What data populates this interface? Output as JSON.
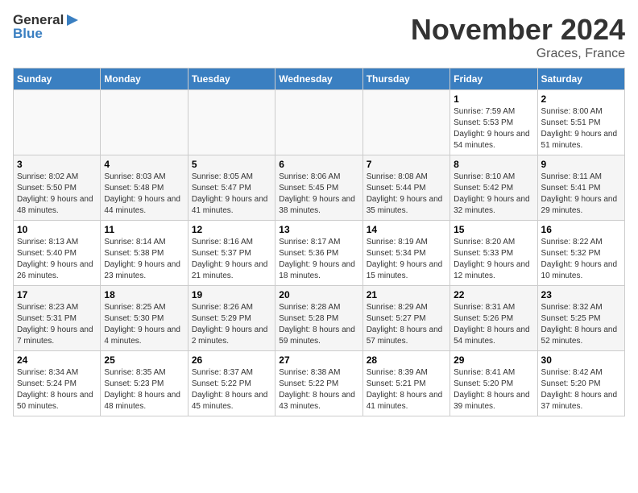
{
  "header": {
    "logo_general": "General",
    "logo_blue": "Blue",
    "month_title": "November 2024",
    "location": "Graces, France"
  },
  "days_of_week": [
    "Sunday",
    "Monday",
    "Tuesday",
    "Wednesday",
    "Thursday",
    "Friday",
    "Saturday"
  ],
  "weeks": [
    [
      {
        "day": "",
        "detail": ""
      },
      {
        "day": "",
        "detail": ""
      },
      {
        "day": "",
        "detail": ""
      },
      {
        "day": "",
        "detail": ""
      },
      {
        "day": "",
        "detail": ""
      },
      {
        "day": "1",
        "detail": "Sunrise: 7:59 AM\nSunset: 5:53 PM\nDaylight: 9 hours\nand 54 minutes."
      },
      {
        "day": "2",
        "detail": "Sunrise: 8:00 AM\nSunset: 5:51 PM\nDaylight: 9 hours\nand 51 minutes."
      }
    ],
    [
      {
        "day": "3",
        "detail": "Sunrise: 8:02 AM\nSunset: 5:50 PM\nDaylight: 9 hours\nand 48 minutes."
      },
      {
        "day": "4",
        "detail": "Sunrise: 8:03 AM\nSunset: 5:48 PM\nDaylight: 9 hours\nand 44 minutes."
      },
      {
        "day": "5",
        "detail": "Sunrise: 8:05 AM\nSunset: 5:47 PM\nDaylight: 9 hours\nand 41 minutes."
      },
      {
        "day": "6",
        "detail": "Sunrise: 8:06 AM\nSunset: 5:45 PM\nDaylight: 9 hours\nand 38 minutes."
      },
      {
        "day": "7",
        "detail": "Sunrise: 8:08 AM\nSunset: 5:44 PM\nDaylight: 9 hours\nand 35 minutes."
      },
      {
        "day": "8",
        "detail": "Sunrise: 8:10 AM\nSunset: 5:42 PM\nDaylight: 9 hours\nand 32 minutes."
      },
      {
        "day": "9",
        "detail": "Sunrise: 8:11 AM\nSunset: 5:41 PM\nDaylight: 9 hours\nand 29 minutes."
      }
    ],
    [
      {
        "day": "10",
        "detail": "Sunrise: 8:13 AM\nSunset: 5:40 PM\nDaylight: 9 hours\nand 26 minutes."
      },
      {
        "day": "11",
        "detail": "Sunrise: 8:14 AM\nSunset: 5:38 PM\nDaylight: 9 hours\nand 23 minutes."
      },
      {
        "day": "12",
        "detail": "Sunrise: 8:16 AM\nSunset: 5:37 PM\nDaylight: 9 hours\nand 21 minutes."
      },
      {
        "day": "13",
        "detail": "Sunrise: 8:17 AM\nSunset: 5:36 PM\nDaylight: 9 hours\nand 18 minutes."
      },
      {
        "day": "14",
        "detail": "Sunrise: 8:19 AM\nSunset: 5:34 PM\nDaylight: 9 hours\nand 15 minutes."
      },
      {
        "day": "15",
        "detail": "Sunrise: 8:20 AM\nSunset: 5:33 PM\nDaylight: 9 hours\nand 12 minutes."
      },
      {
        "day": "16",
        "detail": "Sunrise: 8:22 AM\nSunset: 5:32 PM\nDaylight: 9 hours\nand 10 minutes."
      }
    ],
    [
      {
        "day": "17",
        "detail": "Sunrise: 8:23 AM\nSunset: 5:31 PM\nDaylight: 9 hours\nand 7 minutes."
      },
      {
        "day": "18",
        "detail": "Sunrise: 8:25 AM\nSunset: 5:30 PM\nDaylight: 9 hours\nand 4 minutes."
      },
      {
        "day": "19",
        "detail": "Sunrise: 8:26 AM\nSunset: 5:29 PM\nDaylight: 9 hours\nand 2 minutes."
      },
      {
        "day": "20",
        "detail": "Sunrise: 8:28 AM\nSunset: 5:28 PM\nDaylight: 8 hours\nand 59 minutes."
      },
      {
        "day": "21",
        "detail": "Sunrise: 8:29 AM\nSunset: 5:27 PM\nDaylight: 8 hours\nand 57 minutes."
      },
      {
        "day": "22",
        "detail": "Sunrise: 8:31 AM\nSunset: 5:26 PM\nDaylight: 8 hours\nand 54 minutes."
      },
      {
        "day": "23",
        "detail": "Sunrise: 8:32 AM\nSunset: 5:25 PM\nDaylight: 8 hours\nand 52 minutes."
      }
    ],
    [
      {
        "day": "24",
        "detail": "Sunrise: 8:34 AM\nSunset: 5:24 PM\nDaylight: 8 hours\nand 50 minutes."
      },
      {
        "day": "25",
        "detail": "Sunrise: 8:35 AM\nSunset: 5:23 PM\nDaylight: 8 hours\nand 48 minutes."
      },
      {
        "day": "26",
        "detail": "Sunrise: 8:37 AM\nSunset: 5:22 PM\nDaylight: 8 hours\nand 45 minutes."
      },
      {
        "day": "27",
        "detail": "Sunrise: 8:38 AM\nSunset: 5:22 PM\nDaylight: 8 hours\nand 43 minutes."
      },
      {
        "day": "28",
        "detail": "Sunrise: 8:39 AM\nSunset: 5:21 PM\nDaylight: 8 hours\nand 41 minutes."
      },
      {
        "day": "29",
        "detail": "Sunrise: 8:41 AM\nSunset: 5:20 PM\nDaylight: 8 hours\nand 39 minutes."
      },
      {
        "day": "30",
        "detail": "Sunrise: 8:42 AM\nSunset: 5:20 PM\nDaylight: 8 hours\nand 37 minutes."
      }
    ]
  ]
}
